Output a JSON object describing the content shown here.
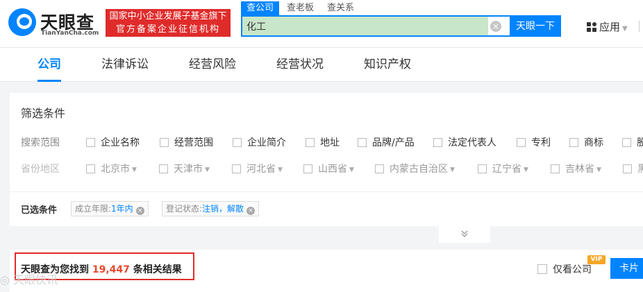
{
  "header": {
    "logo_text": "天眼查",
    "logo_sub": "TianYanCha.com",
    "gov_badge_line1": "国家中小企业发展子基金旗下",
    "gov_badge_line2": "官方备案企业征信机构",
    "search_tabs": [
      "查公司",
      "查老板",
      "查关系"
    ],
    "search_value": "化工",
    "search_button": "天眼一下",
    "apps_label": "应用"
  },
  "nav": {
    "tabs": [
      "公司",
      "法律诉讼",
      "经营风险",
      "经营状况",
      "知识产权"
    ],
    "active": "公司"
  },
  "filter": {
    "title": "筛选条件",
    "scope_label": "搜索范围",
    "scope_options": [
      "企业名称",
      "经营范围",
      "企业简介",
      "地址",
      "品牌/产品",
      "法定代表人",
      "专利",
      "商标",
      "股"
    ],
    "region_label": "省份地区",
    "region_options": [
      "北京市",
      "天津市",
      "河北省",
      "山西省",
      "内蒙古自治区",
      "辽宁省",
      "吉林省",
      "黑"
    ],
    "selected_label": "已选条件",
    "chips": [
      {
        "key": "成立年限:",
        "value": "1年内"
      },
      {
        "key": "登记状态:",
        "value": "注销，解散"
      }
    ]
  },
  "results": {
    "prefix": "天眼查为您找到",
    "count": "19,447",
    "suffix": "条相关结果",
    "only_company": "仅看公司",
    "vip": "VIP",
    "card_button": "卡片",
    "watermark": "天眼快讯"
  },
  "colors": {
    "accent": "#0084ff",
    "red": "#e02b2b",
    "count": "#e8492e"
  }
}
